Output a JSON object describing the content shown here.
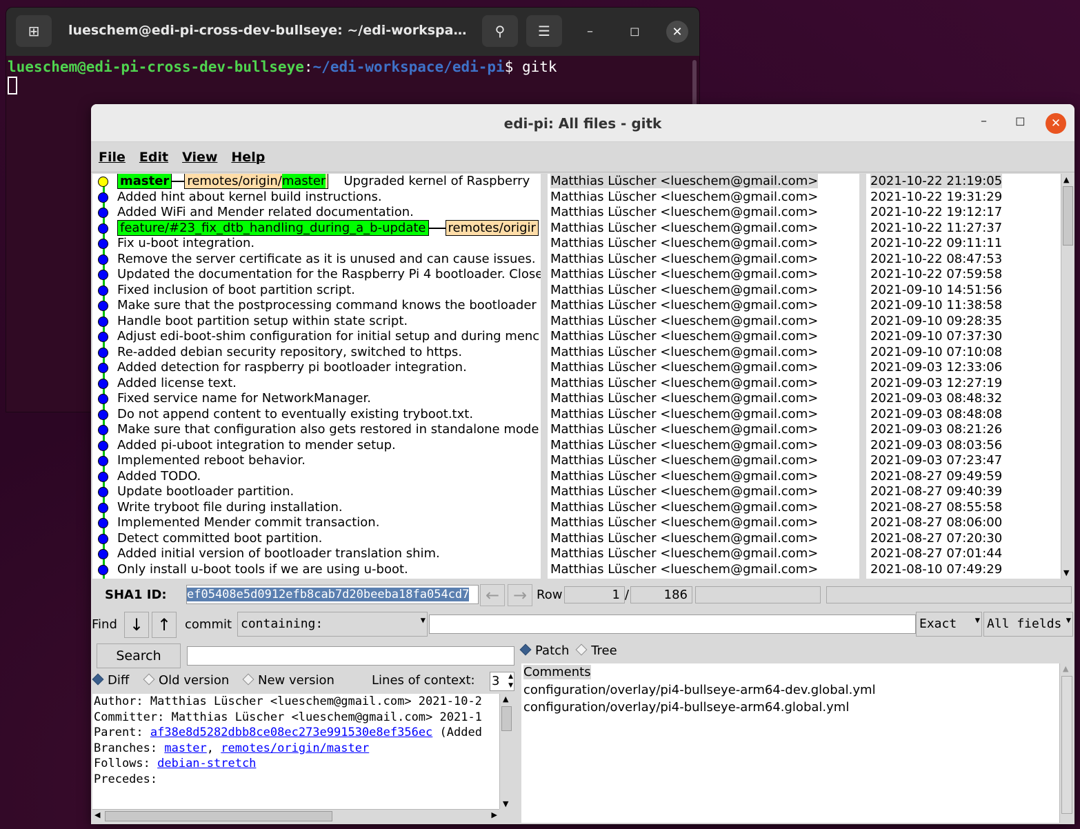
{
  "terminal": {
    "title": "lueschem@edi-pi-cross-dev-bullseye: ~/edi-workspa…",
    "prompt_user": "lueschem@edi-pi-cross-dev-bullseye",
    "prompt_sep": ":",
    "prompt_path": "~/edi-workspace/edi-pi",
    "prompt_cmd": "$ gitk",
    "icons": [
      "new-tab-icon",
      "search-icon",
      "hamburger-menu-icon",
      "minimize-icon",
      "maximize-icon",
      "close-icon"
    ]
  },
  "gitk": {
    "title": "edi-pi: All files - gitk",
    "menu": [
      "File",
      "Edit",
      "View",
      "Help"
    ],
    "refs_row0": {
      "head": "master",
      "remote_prefix": "remotes/origin/",
      "remote_branch": "master"
    },
    "refs_row3": {
      "branch": "feature/#23_fix_dtb_handling_during_a_b-update",
      "remote": "remotes/origir"
    },
    "commits": [
      {
        "msg": "Upgraded kernel of Raspberry",
        "author": "Matthias Lüscher <lueschem@gmail.com>",
        "date": "2021-10-22 21:19:05"
      },
      {
        "msg": "Added hint about kernel build instructions.",
        "author": "Matthias Lüscher <lueschem@gmail.com>",
        "date": "2021-10-22 19:31:29"
      },
      {
        "msg": "Added WiFi and Mender related documentation.",
        "author": "Matthias Lüscher <lueschem@gmail.com>",
        "date": "2021-10-22 19:12:17"
      },
      {
        "msg": "",
        "author": "Matthias Lüscher <lueschem@gmail.com>",
        "date": "2021-10-22 11:27:37"
      },
      {
        "msg": "Fix u-boot integration.",
        "author": "Matthias Lüscher <lueschem@gmail.com>",
        "date": "2021-10-22 09:11:11"
      },
      {
        "msg": "Remove the server certificate as it is unused and can cause issues.",
        "author": "Matthias Lüscher <lueschem@gmail.com>",
        "date": "2021-10-22 08:47:53"
      },
      {
        "msg": "Updated the documentation for the Raspberry Pi 4 bootloader. Close",
        "author": "Matthias Lüscher <lueschem@gmail.com>",
        "date": "2021-10-22 07:59:58"
      },
      {
        "msg": "Fixed inclusion of boot partition script.",
        "author": "Matthias Lüscher <lueschem@gmail.com>",
        "date": "2021-09-10 14:51:56"
      },
      {
        "msg": "Make sure that the postprocessing command knows the bootloader",
        "author": "Matthias Lüscher <lueschem@gmail.com>",
        "date": "2021-09-10 11:38:58"
      },
      {
        "msg": "Handle boot partition setup within state script.",
        "author": "Matthias Lüscher <lueschem@gmail.com>",
        "date": "2021-09-10 09:28:35"
      },
      {
        "msg": "Adjust edi-boot-shim configuration for initial setup and during menc",
        "author": "Matthias Lüscher <lueschem@gmail.com>",
        "date": "2021-09-10 07:37:30"
      },
      {
        "msg": "Re-added debian security repository, switched to https.",
        "author": "Matthias Lüscher <lueschem@gmail.com>",
        "date": "2021-09-10 07:10:08"
      },
      {
        "msg": "Added detection for raspberry pi bootloader integration.",
        "author": "Matthias Lüscher <lueschem@gmail.com>",
        "date": "2021-09-03 12:33:06"
      },
      {
        "msg": "Added license text.",
        "author": "Matthias Lüscher <lueschem@gmail.com>",
        "date": "2021-09-03 12:27:19"
      },
      {
        "msg": "Fixed service name for NetworkManager.",
        "author": "Matthias Lüscher <lueschem@gmail.com>",
        "date": "2021-09-03 08:48:32"
      },
      {
        "msg": "Do not append content to eventually existing tryboot.txt.",
        "author": "Matthias Lüscher <lueschem@gmail.com>",
        "date": "2021-09-03 08:48:08"
      },
      {
        "msg": "Make sure that configuration also gets restored in standalone mode",
        "author": "Matthias Lüscher <lueschem@gmail.com>",
        "date": "2021-09-03 08:21:26"
      },
      {
        "msg": "Added pi-uboot integration to mender setup.",
        "author": "Matthias Lüscher <lueschem@gmail.com>",
        "date": "2021-09-03 08:03:56"
      },
      {
        "msg": "Implemented reboot behavior.",
        "author": "Matthias Lüscher <lueschem@gmail.com>",
        "date": "2021-09-03 07:23:47"
      },
      {
        "msg": "Added TODO.",
        "author": "Matthias Lüscher <lueschem@gmail.com>",
        "date": "2021-08-27 09:49:59"
      },
      {
        "msg": "Update bootloader partition.",
        "author": "Matthias Lüscher <lueschem@gmail.com>",
        "date": "2021-08-27 09:40:39"
      },
      {
        "msg": "Write tryboot file during installation.",
        "author": "Matthias Lüscher <lueschem@gmail.com>",
        "date": "2021-08-27 08:55:58"
      },
      {
        "msg": "Implemented Mender commit transaction.",
        "author": "Matthias Lüscher <lueschem@gmail.com>",
        "date": "2021-08-27 08:06:00"
      },
      {
        "msg": "Detect committed boot partition.",
        "author": "Matthias Lüscher <lueschem@gmail.com>",
        "date": "2021-08-27 07:20:30"
      },
      {
        "msg": "Added initial version of bootloader translation shim.",
        "author": "Matthias Lüscher <lueschem@gmail.com>",
        "date": "2021-08-27 07:01:44"
      },
      {
        "msg": "Only install u-boot tools if we are using u-boot.",
        "author": "Matthias Lüscher <lueschem@gmail.com>",
        "date": "2021-08-10 07:49:29"
      }
    ],
    "sha": {
      "label": "SHA1 ID:",
      "value": "ef05408e5d0912efb8cab7d20beeba18fa054cd7",
      "row_label": "Row",
      "row_current": "1",
      "row_sep": "/",
      "row_total": "186"
    },
    "find": {
      "label": "Find",
      "type": "commit",
      "mode": "containing:",
      "match": "Exact",
      "fields": "All fields"
    },
    "search": {
      "button": "Search"
    },
    "diff_options": {
      "diff": "Diff",
      "old": "Old version",
      "new": "New version",
      "context_label": "Lines of context:",
      "context_value": "3"
    },
    "details": {
      "author": "Author: Matthias Lüscher <lueschem@gmail.com>  2021-10-2",
      "committer": "Committer: Matthias Lüscher <lueschem@gmail.com>  2021-1",
      "parent_label": "Parent: ",
      "parent_sha": "af38e8d5282dbb8ce08ec273e991530e8ef356ec",
      "parent_tail": " (Added",
      "branches_label": "Branches: ",
      "branch1": "master",
      "branch_sep": ", ",
      "branch2": "remotes/origin/master",
      "follows_label": "Follows: ",
      "follows": "debian-stretch",
      "precedes_label": "Precedes:"
    },
    "patch_tree": {
      "patch": "Patch",
      "tree": "Tree"
    },
    "files": {
      "comments": "Comments",
      "list": [
        "configuration/overlay/pi4-bullseye-arm64-dev.global.yml",
        "configuration/overlay/pi4-bullseye-arm64.global.yml"
      ]
    }
  }
}
